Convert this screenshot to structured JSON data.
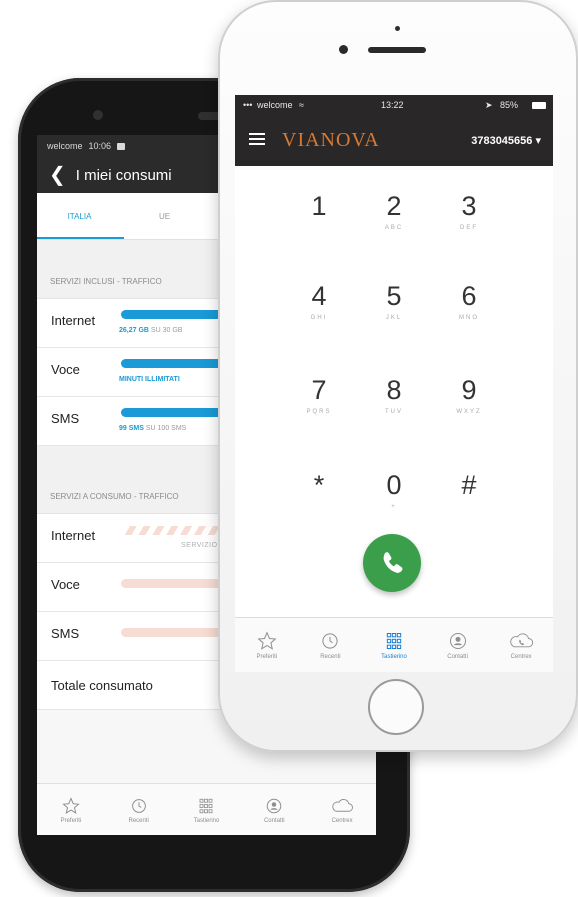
{
  "back_phone": {
    "status": {
      "carrier": "welcome",
      "time": "10:06"
    },
    "title": "I miei consumi",
    "tabs": [
      {
        "label": "ITALIA",
        "active": true
      },
      {
        "label": "UE",
        "active": false
      }
    ],
    "section_included": "SERVIZI INCLUSI - TRAFFICO",
    "included_rows": [
      {
        "label": "Internet",
        "amount": "26,27 GB",
        "detail": "SU 30 GB"
      },
      {
        "label": "Voce",
        "amount": "MINUTI ILLIMITATI",
        "detail": ""
      },
      {
        "label": "SMS",
        "amount": "99 SMS",
        "detail": "SU 100 SMS"
      }
    ],
    "section_consumption": "SERVIZI A CONSUMO - TRAFFICO",
    "consumption_rows": [
      {
        "label": "Internet",
        "note": "SERVIZIO"
      },
      {
        "label": "Voce"
      },
      {
        "label": "SMS"
      }
    ],
    "total_label": "Totale consumato",
    "tabbar": [
      {
        "icon": "star-icon",
        "label": "Preferiti"
      },
      {
        "icon": "history-icon",
        "label": "Recenti"
      },
      {
        "icon": "keypad-icon",
        "label": "Tastierino"
      },
      {
        "icon": "contact-icon",
        "label": "Contatti"
      },
      {
        "icon": "cloud-phone-icon",
        "label": "Centrex"
      }
    ]
  },
  "front_phone": {
    "status": {
      "carrier": "welcome",
      "time": "13:22",
      "battery": "85%"
    },
    "brand": "VIANOVA",
    "phone_number": "3783045656",
    "keys": [
      {
        "digit": "1",
        "letters": ""
      },
      {
        "digit": "2",
        "letters": "ABC"
      },
      {
        "digit": "3",
        "letters": "DEF"
      },
      {
        "digit": "4",
        "letters": "GHI"
      },
      {
        "digit": "5",
        "letters": "JKL"
      },
      {
        "digit": "6",
        "letters": "MNO"
      },
      {
        "digit": "7",
        "letters": "PQRS"
      },
      {
        "digit": "8",
        "letters": "TUV"
      },
      {
        "digit": "9",
        "letters": "WXYZ"
      },
      {
        "digit": "*",
        "letters": ""
      },
      {
        "digit": "0",
        "letters": "+"
      },
      {
        "digit": "#",
        "letters": ""
      }
    ],
    "tabbar": [
      {
        "icon": "star-icon",
        "label": "Preferiti",
        "active": false
      },
      {
        "icon": "history-icon",
        "label": "Recenti",
        "active": false
      },
      {
        "icon": "keypad-icon",
        "label": "Tastierino",
        "active": true
      },
      {
        "icon": "contact-icon",
        "label": "Contatti",
        "active": false
      },
      {
        "icon": "cloud-phone-icon",
        "label": "Centrex",
        "active": false
      }
    ]
  },
  "colors": {
    "accent_blue": "#1a9ad6",
    "brand_orange": "#d67a35",
    "call_green": "#3b9e4b",
    "light_salmon": "#f6dcd2"
  }
}
